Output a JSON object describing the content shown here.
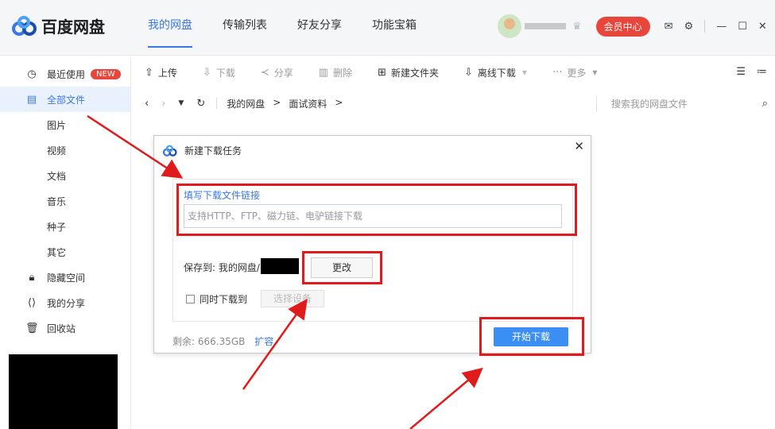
{
  "app": {
    "title": "百度网盘"
  },
  "nav": {
    "tabs": [
      {
        "label": "我的网盘",
        "active": true
      },
      {
        "label": "传输列表"
      },
      {
        "label": "好友分享"
      },
      {
        "label": "功能宝箱"
      }
    ]
  },
  "user": {
    "vip_label": "会员中心"
  },
  "sidebar": {
    "items": [
      {
        "label": "最近使用",
        "icon": "clock-icon",
        "badge": "NEW"
      },
      {
        "label": "全部文件",
        "icon": "file-icon",
        "active": true
      },
      {
        "label": "图片"
      },
      {
        "label": "视频"
      },
      {
        "label": "文档"
      },
      {
        "label": "音乐"
      },
      {
        "label": "种子"
      },
      {
        "label": "其它"
      },
      {
        "label": "隐藏空间",
        "icon": "lock-icon"
      },
      {
        "label": "我的分享",
        "icon": "share-icon"
      },
      {
        "label": "回收站",
        "icon": "trash-icon"
      }
    ]
  },
  "toolbar": {
    "upload": "上传",
    "download": "下载",
    "share": "分享",
    "delete": "删除",
    "new_folder": "新建文件夹",
    "offline": "离线下载",
    "more": "更多"
  },
  "path": {
    "crumbs": [
      "我的网盘",
      ">",
      "面试资料",
      ">"
    ],
    "search_placeholder": "搜索我的网盘文件"
  },
  "dialog": {
    "title": "新建下载任务",
    "url_label": "填写下载文件链接",
    "url_placeholder": "支持HTTP、FTP、磁力链、电驴链接下载",
    "save_to": "保存到: 我的网盘/",
    "change": "更改",
    "sim_download": "同时下载到",
    "choose_device": "选择设备",
    "remaining": "剩余: 666.35GB",
    "expand": "扩容",
    "start": "开始下载"
  },
  "colors": {
    "accent": "#3b78e7",
    "vip": "#e8463b",
    "annotation": "#e01b1b",
    "start_button": "#3b8ef4"
  }
}
